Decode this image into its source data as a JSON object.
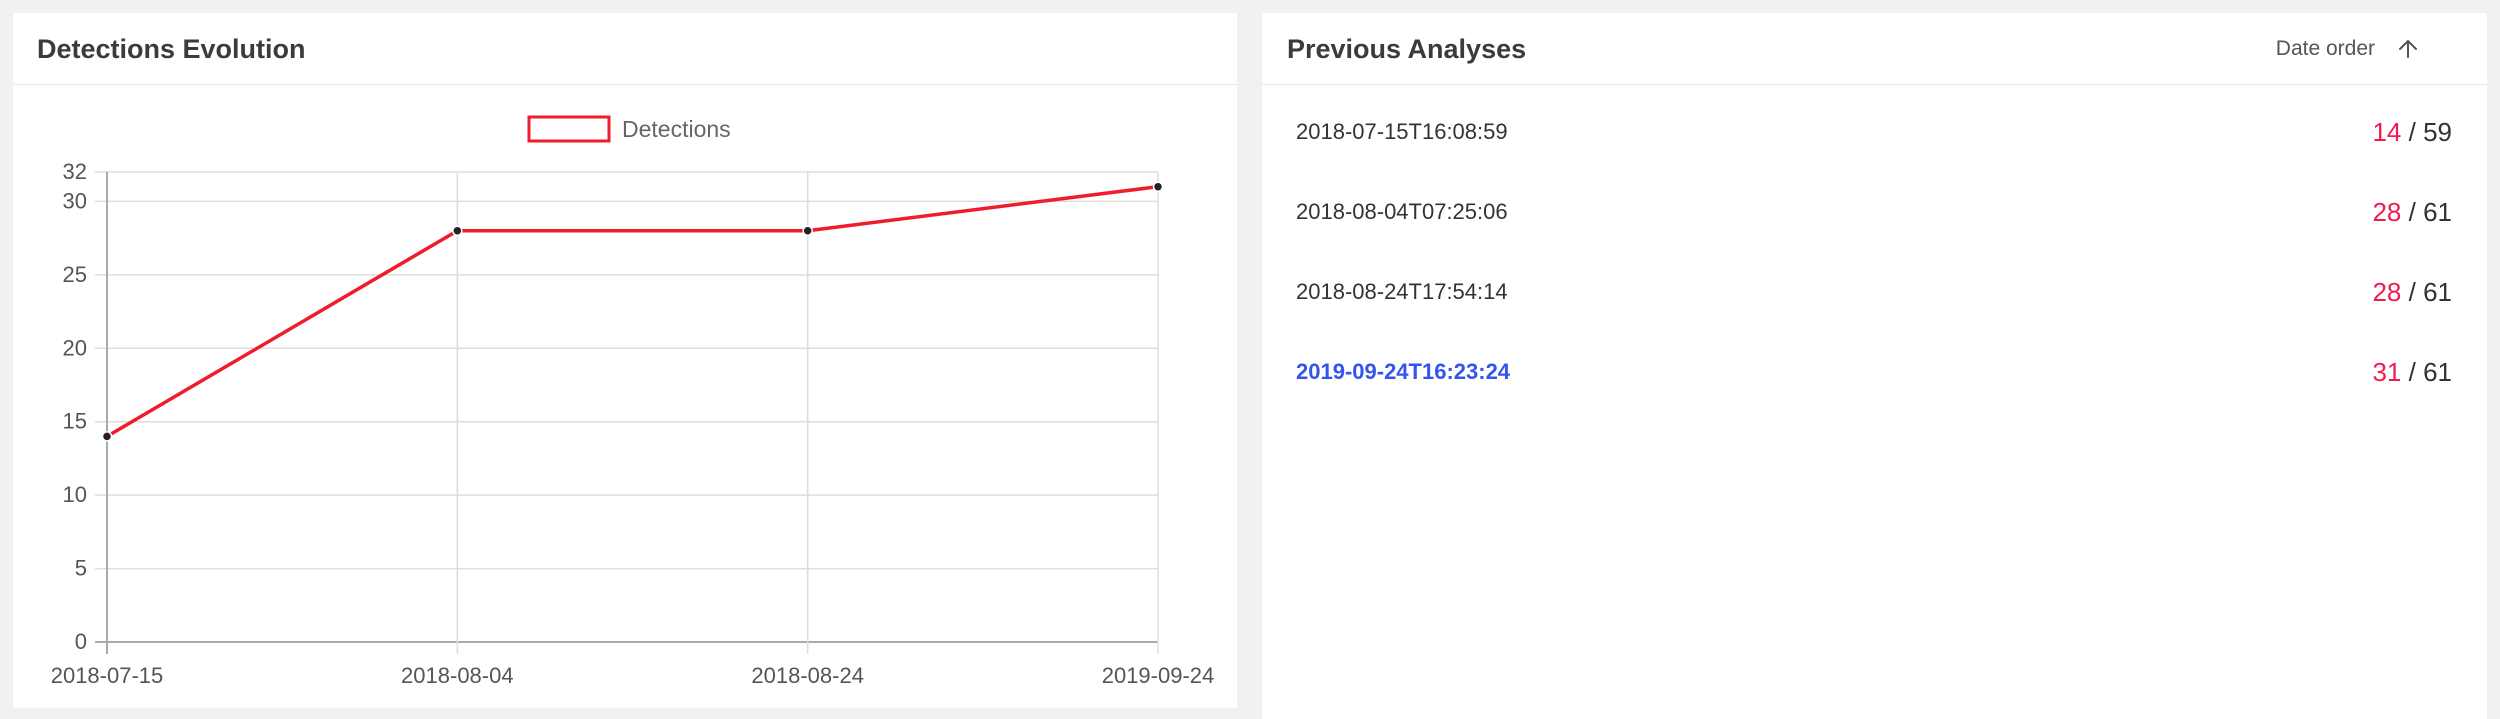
{
  "left_panel": {
    "title": "Detections Evolution"
  },
  "chart_data": {
    "type": "line",
    "x": [
      "2018-07-15",
      "2018-08-04",
      "2018-08-24",
      "2019-09-24"
    ],
    "series": [
      {
        "name": "Detections",
        "values": [
          14,
          28,
          28,
          31
        ],
        "color": "#ef1c2c"
      }
    ],
    "yticks": [
      0,
      5,
      10,
      15,
      20,
      25,
      30,
      32
    ],
    "ylim": [
      0,
      32
    ],
    "grid": true,
    "legend_position": "top-center",
    "point_color": "#222222",
    "grid_color": "#dddddd"
  },
  "right_panel": {
    "title": "Previous Analyses",
    "sort_label": "Date order",
    "sort_icon": "arrow-up-icon",
    "analyses": [
      {
        "date": "2018-07-15T16:08:59",
        "detections": "14",
        "separator": "/",
        "total": "59",
        "active": false
      },
      {
        "date": "2018-08-04T07:25:06",
        "detections": "28",
        "separator": "/",
        "total": "61",
        "active": false
      },
      {
        "date": "2018-08-24T17:54:14",
        "detections": "28",
        "separator": "/",
        "total": "61",
        "active": false
      },
      {
        "date": "2019-09-24T16:23:24",
        "detections": "31",
        "separator": "/",
        "total": "61",
        "active": true
      }
    ]
  },
  "colors": {
    "accent_link": "#3355ee",
    "detection_red": "#ef1c4f",
    "background": "#f1f1f1"
  }
}
